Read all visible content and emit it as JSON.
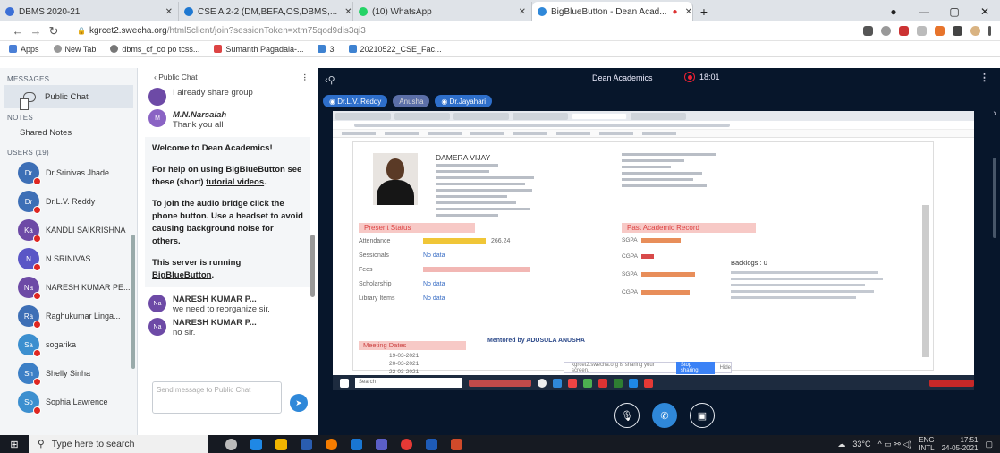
{
  "browser": {
    "tabs": [
      {
        "title": "DBMS 2020-21",
        "active": false,
        "color": "#3b6fd6"
      },
      {
        "title": "CSE A 2-2 (DM,BEFA,OS,DBMS,...",
        "active": false,
        "color": "#1f78d1"
      },
      {
        "title": "(10) WhatsApp",
        "active": false,
        "color": "#25d366"
      },
      {
        "title": "BigBlueButton - Dean Acad...",
        "active": true,
        "color": "#2f88d9"
      }
    ],
    "new_tab": "+",
    "window_controls": [
      "—",
      "▢",
      "✕"
    ],
    "url_main": "kgrcet2.swecha.org",
    "url_rest": "/html5client/join?sessionToken=xtm75qod9dis3qi3",
    "bookmarks": [
      {
        "label": "Apps",
        "color": "#4a7fd6"
      },
      {
        "label": "New Tab",
        "color": "#999"
      },
      {
        "label": "dbms_cf_co po tcss...",
        "color": "#777"
      },
      {
        "label": "Sumanth Pagadala-...",
        "color": "#d44"
      },
      {
        "label": "3",
        "color": "#3e82d1"
      },
      {
        "label": "20210522_CSE_Fac...",
        "color": "#3e82d1"
      }
    ]
  },
  "sidebar": {
    "messages_label": "MESSAGES",
    "public_chat": "Public Chat",
    "notes_label": "NOTES",
    "shared_notes": "Shared Notes",
    "users_label": "USERS (19)",
    "users": [
      {
        "initials": "Dr",
        "name": "Dr Srinivas Jhade",
        "color": "#3d6fb6"
      },
      {
        "initials": "Dr",
        "name": "Dr.L.V. Reddy",
        "color": "#3d6fb6"
      },
      {
        "initials": "Ka",
        "name": "KANDLI SAIKRISHNA",
        "color": "#6d4aa6"
      },
      {
        "initials": "N",
        "name": "N SRINIVAS",
        "color": "#5a56c6"
      },
      {
        "initials": "Na",
        "name": "NARESH KUMAR PE...",
        "color": "#6d4aa6"
      },
      {
        "initials": "Ra",
        "name": "Raghukumar Linga...",
        "color": "#3d6fb6"
      },
      {
        "initials": "Sa",
        "name": "sogarika",
        "color": "#3c8fcf"
      },
      {
        "initials": "Sh",
        "name": "Shelly Sinha",
        "color": "#3c7fc6"
      },
      {
        "initials": "So",
        "name": "Sophia Lawrence",
        "color": "#3c8fcf"
      }
    ]
  },
  "chat": {
    "back_label": "Public Chat",
    "more": "⋮",
    "top_text": "I already share group",
    "msg1": {
      "initials": "M",
      "name": "M.N.Narsaiah",
      "text": "Thank you all"
    },
    "welcome": "Welcome to Dean Academics!",
    "help1": "For help on using BigBlueButton see these (short)",
    "help_link": "tutorial videos",
    "help2": "To join the audio bridge click the phone button. Use a headset to avoid causing background noise for others.",
    "server": "This server is running",
    "server_link": "BigBlueButton",
    "msg2": {
      "initials": "Na",
      "name": "NARESH KUMAR P...",
      "text": "we need to reorganize sir."
    },
    "msg3": {
      "initials": "Na",
      "name": "NARESH KUMAR P...",
      "text": "no sir."
    },
    "input_placeholder": "Send message to Public Chat"
  },
  "meeting": {
    "title": "Dean Academics",
    "recording_time": "18:01",
    "presenters": [
      "Dr.L.V. Reddy",
      "Anusha",
      "Dr.Jayahari"
    ]
  },
  "shared_screen": {
    "student_name": "DAMERA VIJAY",
    "present_status": "Present Status",
    "rows": [
      {
        "label": "Attendance",
        "value": "266.24"
      },
      {
        "label": "Sessionals",
        "value": "No data"
      },
      {
        "label": "Fees",
        "value": ""
      },
      {
        "label": "Scholarship",
        "value": "No data"
      },
      {
        "label": "Library Items",
        "value": "No data"
      }
    ],
    "past_record": "Past Academic Record",
    "backlogs": "Backlogs : 0",
    "mentored_by": "Mentored by ADUSULA ANUSHA",
    "meeting_dates_label": "Meeting Dates",
    "meeting_dates": [
      "19-03-2021",
      "20-03-2021",
      "22-03-2021"
    ],
    "search": "Search",
    "notification": "kgrcet2.swecha.org is sharing your screen.",
    "notif_button": "Stop sharing",
    "notif_hide": "Hide"
  },
  "taskbar": {
    "search_placeholder": "Type here to search",
    "temperature": "33°C",
    "lang": "ENG",
    "lang2": "INTL",
    "time": "17:51",
    "date": "24-05-2021"
  }
}
